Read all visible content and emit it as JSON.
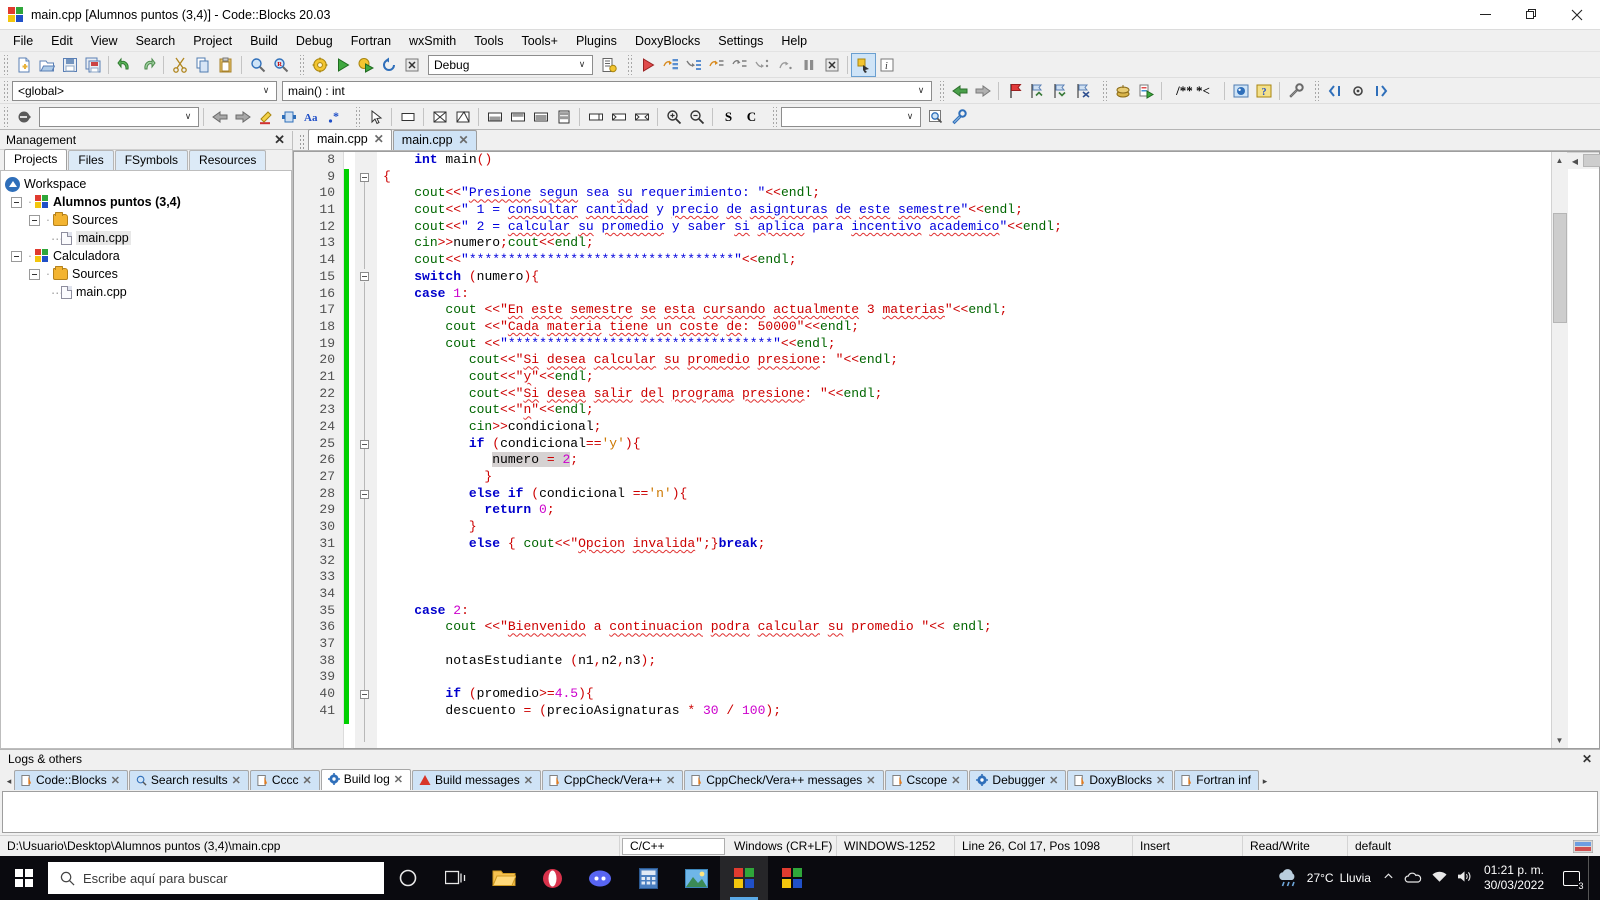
{
  "window": {
    "title": "main.cpp [Alumnos puntos (3,4)] - Code::Blocks 20.03",
    "minimize_label": "–",
    "restore_label": "❐",
    "close_label": "✕"
  },
  "menubar": {
    "items": [
      {
        "label": "File"
      },
      {
        "label": "Edit"
      },
      {
        "label": "View"
      },
      {
        "label": "Search"
      },
      {
        "label": "Project"
      },
      {
        "label": "Build"
      },
      {
        "label": "Debug"
      },
      {
        "label": "Fortran"
      },
      {
        "label": "wxSmith"
      },
      {
        "label": "Tools"
      },
      {
        "label": "Tools+"
      },
      {
        "label": "Plugins"
      },
      {
        "label": "DoxyBlocks"
      },
      {
        "label": "Settings"
      },
      {
        "label": "Help"
      }
    ]
  },
  "toolbars": {
    "main_icons": [
      "new-file-icon",
      "open-file-icon",
      "save-icon",
      "save-all-icon",
      "undo-icon",
      "redo-icon",
      "cut-icon",
      "copy-icon",
      "paste-icon",
      "find-icon",
      "replace-icon"
    ],
    "compiler_icons": [
      "build-icon",
      "run-icon",
      "build-and-run-icon",
      "rebuild-icon",
      "abort-icon"
    ],
    "target_select": {
      "value": "Debug",
      "arrow": "∨"
    },
    "build_target_extra_icon": "build-target-options-icon",
    "debug_icons": [
      "debug-continue-icon",
      "next-line-icon",
      "step-into-icon",
      "step-out-icon",
      "next-instruction-icon",
      "step-into-instruction-icon",
      "step-out-instruction-icon",
      "break-debugger-icon",
      "stop-debugger-icon"
    ],
    "debug_window_icons": [
      "debugging-windows-icon",
      "various-info-icon"
    ],
    "scope": {
      "global_value": "<global>",
      "arrow": "∨",
      "function_value": "main() : int",
      "function_arrow": "∨"
    },
    "nav_icons": [
      "back-icon",
      "forward-icon",
      "toggle-bookmark-icon",
      "previous-bookmark-icon",
      "next-bookmark-icon",
      "clear-bookmarks-icon"
    ],
    "doxy_icons": [
      "doxyblocks-run-icon",
      "doxyblocks-extract-icon"
    ],
    "doxy_comment_label": "/** *<",
    "doxy_extra_icons": [
      "doxywizard-icon",
      "help-icon",
      "doxyblocks-config-icon"
    ],
    "fold_icons": [
      "fold-all-icon",
      "fold-current-icon",
      "unfold-all-icon"
    ],
    "incremental_search": {
      "value": "",
      "arrow": "∨"
    },
    "second_row_icons": [
      "clear-search-icon",
      "prev-match-icon",
      "next-match-icon",
      "highlight-icon",
      "select-icon",
      "match-case-icon",
      "regex-icon"
    ],
    "wxsmith_icons": [
      "pointer-icon",
      "panel-icon",
      "grid-sizer-icon",
      "flex-grid-sizer-icon",
      "box-sizer-h-icon",
      "box-sizer-v-icon",
      "static-box-sizer-icon",
      "spacer-icon",
      "stretch-spacer-icon",
      "expand-icon"
    ],
    "zoom_icons": [
      "zoom-in-icon",
      "zoom-out-icon"
    ],
    "fortran_labels": [
      "S",
      "C"
    ],
    "fortran_combo": {
      "value": "",
      "arrow": "∨"
    },
    "fortran_icons": [
      "fortran-search-icon",
      "fortran-tools-icon"
    ]
  },
  "management": {
    "title": "Management",
    "close_label": "✕",
    "tabs": [
      {
        "label": "Projects",
        "active": true
      },
      {
        "label": "Files",
        "active": false
      },
      {
        "label": "FSymbols",
        "active": false
      },
      {
        "label": "Resources",
        "active": false
      }
    ],
    "tree": [
      {
        "label": "Workspace",
        "level": 0,
        "icon": "workspace-icon",
        "bold": false,
        "selected": false
      },
      {
        "label": "Alumnos puntos (3,4)",
        "level": 1,
        "icon": "project-icon",
        "bold": true,
        "selected": false
      },
      {
        "label": "Sources",
        "level": 2,
        "icon": "folder-icon",
        "bold": false,
        "selected": false
      },
      {
        "label": "main.cpp",
        "level": 3,
        "icon": "file-icon",
        "bold": false,
        "selected": true
      },
      {
        "label": "Calculadora",
        "level": 1,
        "icon": "project-icon",
        "bold": false,
        "selected": false
      },
      {
        "label": "Sources",
        "level": 2,
        "icon": "folder-icon",
        "bold": false,
        "selected": false
      },
      {
        "label": "main.cpp",
        "level": 3,
        "icon": "file-icon",
        "bold": false,
        "selected": false
      }
    ]
  },
  "editor": {
    "tabs": [
      {
        "label": "main.cpp",
        "close": "✕",
        "active": true
      },
      {
        "label": "main.cpp",
        "close": "✕",
        "active": false
      }
    ],
    "first_line_number": 8,
    "lines": [
      {
        "n": 8,
        "text": "    int main()"
      },
      {
        "n": 9,
        "text": "{"
      },
      {
        "n": 10,
        "text": "    cout<<\"Presione segun sea su requerimiento: \"<<endl;"
      },
      {
        "n": 11,
        "text": "    cout<<\" 1 = consultar cantidad y precio de asignturas de este semestre\"<<endl;"
      },
      {
        "n": 12,
        "text": "    cout<<\" 2 = calcular su promedio y saber si aplica para incentivo academico\"<<endl;"
      },
      {
        "n": 13,
        "text": "    cin>>numero;cout<<endl;"
      },
      {
        "n": 14,
        "text": "    cout<<\"**********************************\"<<endl;"
      },
      {
        "n": 15,
        "text": "    switch (numero){"
      },
      {
        "n": 16,
        "text": "    case 1:"
      },
      {
        "n": 17,
        "text": "        cout <<\"En este semestre se esta cursando actualmente 3 materias\"<<endl;"
      },
      {
        "n": 18,
        "text": "        cout <<\"Cada materia tiene un coste de: 50000\"<<endl;"
      },
      {
        "n": 19,
        "text": "        cout <<\"**********************************\"<<endl;"
      },
      {
        "n": 20,
        "text": "           cout<<\"Si desea calcular su promedio presione: \"<<endl;"
      },
      {
        "n": 21,
        "text": "           cout<<\"y\"<<endl;"
      },
      {
        "n": 22,
        "text": "           cout<<\"Si desea salir del programa presione: \"<<endl;"
      },
      {
        "n": 23,
        "text": "           cout<<\"n\"<<endl;"
      },
      {
        "n": 24,
        "text": "           cin>>condicional;"
      },
      {
        "n": 25,
        "text": "           if (condicional=='y'){"
      },
      {
        "n": 26,
        "text": "               numero = 2;"
      },
      {
        "n": 27,
        "text": "             }"
      },
      {
        "n": 28,
        "text": "           else if (condicional =='n'){"
      },
      {
        "n": 29,
        "text": "             return 0;"
      },
      {
        "n": 30,
        "text": "           }"
      },
      {
        "n": 31,
        "text": "           else { cout<<\"Opcion invalida\";}break;"
      },
      {
        "n": 32,
        "text": ""
      },
      {
        "n": 33,
        "text": ""
      },
      {
        "n": 34,
        "text": ""
      },
      {
        "n": 35,
        "text": "    case 2:"
      },
      {
        "n": 36,
        "text": "        cout <<\"Bienvenido a continuacion podra calcular su promedio \"<< endl;"
      },
      {
        "n": 37,
        "text": ""
      },
      {
        "n": 38,
        "text": "        notasEstudiante (n1,n2,n3);"
      },
      {
        "n": 39,
        "text": ""
      },
      {
        "n": 40,
        "text": "        if (promedio>=4.5){"
      },
      {
        "n": 41,
        "text": "        descuento = (precioAsignaturas * 30 / 100);"
      }
    ]
  },
  "logs": {
    "title": "Logs & others",
    "close_label": "✕",
    "nav_left": "◂",
    "nav_right": "▸",
    "tabs": [
      {
        "label": "Code::Blocks",
        "icon": "log-icon",
        "close": "✕",
        "active": false
      },
      {
        "label": "Search results",
        "icon": "search-icon",
        "close": "✕",
        "active": false
      },
      {
        "label": "Cccc",
        "icon": "log-icon",
        "close": "✕",
        "active": false
      },
      {
        "label": "Build log",
        "icon": "gear-icon",
        "close": "✕",
        "active": true
      },
      {
        "label": "Build messages",
        "icon": "warning-icon",
        "close": "✕",
        "active": false
      },
      {
        "label": "CppCheck/Vera++",
        "icon": "log-icon",
        "close": "✕",
        "active": false
      },
      {
        "label": "CppCheck/Vera++ messages",
        "icon": "log-icon",
        "close": "✕",
        "active": false
      },
      {
        "label": "Cscope",
        "icon": "log-icon",
        "close": "✕",
        "active": false
      },
      {
        "label": "Debugger",
        "icon": "gear-icon",
        "close": "✕",
        "active": false
      },
      {
        "label": "DoxyBlocks",
        "icon": "log-icon",
        "close": "✕",
        "active": false
      },
      {
        "label": "Fortran inf",
        "icon": "log-icon",
        "close": "✕",
        "active": false
      }
    ]
  },
  "statusbar": {
    "path": "D:\\Usuario\\Desktop\\Alumnos puntos (3,4)\\main.cpp",
    "language": "C/C++",
    "line_ending": "Windows (CR+LF)",
    "encoding": "WINDOWS-1252",
    "position": "Line 26, Col 17, Pos 1098",
    "insert_mode": "Insert",
    "access": "Read/Write",
    "profile": "default"
  },
  "taskbar": {
    "search_placeholder": "Escribe aquí para buscar",
    "apps": [
      "cortana-icon",
      "task-view-icon",
      "file-explorer-icon",
      "opera-icon",
      "discord-icon",
      "calculator-icon",
      "photos-icon",
      "codeblocks-icon",
      "store-icon"
    ],
    "weather": {
      "temp": "27°C",
      "condition": "Lluvia",
      "icon": "rain-cloud-icon"
    },
    "tray_icons": [
      "show-hidden-icon",
      "onedrive-icon",
      "network-icon",
      "volume-icon"
    ],
    "time": "01:21 p. m.",
    "date": "30/03/2022",
    "notification_count": "3"
  },
  "colors": {
    "accent": "#0078d7",
    "keyword": "#0000cc",
    "string_red": "#cc0000",
    "string_blue": "#0000dd",
    "number": "#cc00cc",
    "stream": "#006600",
    "char_literal": "#cc7700",
    "breakpoint_bar": "#00d000"
  }
}
